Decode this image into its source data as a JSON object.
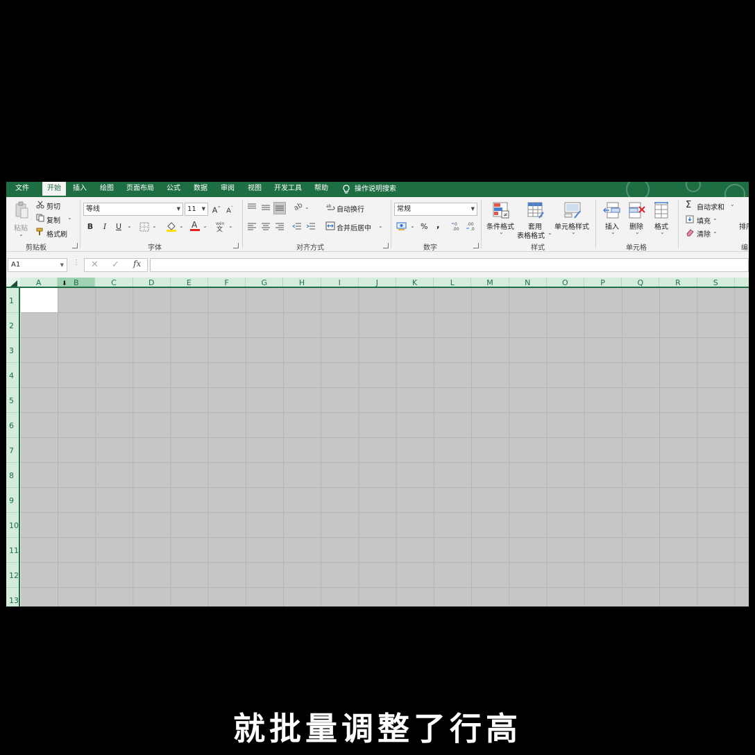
{
  "tabs": {
    "file": "文件",
    "home": "开始",
    "insert": "插入",
    "draw": "绘图",
    "layout": "页面布局",
    "formulas": "公式",
    "data": "数据",
    "review": "审阅",
    "view": "视图",
    "developer": "开发工具",
    "help": "帮助",
    "tell_me": "操作说明搜索"
  },
  "ribbon": {
    "clipboard": {
      "paste": "粘贴",
      "cut": "剪切",
      "copy": "复制",
      "format_painter": "格式刷",
      "label": "剪贴板"
    },
    "font": {
      "name": "等线",
      "size": "11",
      "bold": "B",
      "italic": "I",
      "underline": "U",
      "label": "字体"
    },
    "alignment": {
      "wrap_text": "自动换行",
      "merge_center": "合并后居中",
      "label": "对齐方式"
    },
    "number": {
      "format": "常规",
      "percent": "%",
      "comma": ",",
      "label": "数字"
    },
    "styles": {
      "conditional": "条件格式",
      "table_line1": "套用",
      "table_line2": "表格格式",
      "cell_styles": "单元格样式",
      "label": "样式"
    },
    "cells": {
      "insert": "插入",
      "delete": "删除",
      "format": "格式",
      "label": "单元格"
    },
    "editing": {
      "autosum": "自动求和",
      "fill": "填充",
      "clear": "清除",
      "sort": "排序",
      "label": "编"
    }
  },
  "formula_bar": {
    "name_box": "A1",
    "fx": "fx",
    "content": ""
  },
  "grid": {
    "columns": [
      "A",
      "B",
      "C",
      "D",
      "E",
      "F",
      "G",
      "H",
      "I",
      "J",
      "K",
      "L",
      "M",
      "N",
      "O",
      "P",
      "Q",
      "R",
      "S"
    ],
    "rows": [
      "1",
      "2",
      "3",
      "4",
      "5",
      "6",
      "7",
      "8",
      "9",
      "10",
      "11",
      "12",
      "13"
    ],
    "selected_column": "B"
  },
  "caption": "就批量调整了行高",
  "colors": {
    "accent": "#1e6e44",
    "header_bg": "#d3ecdc",
    "selection_shade": "#c6c6c6"
  }
}
